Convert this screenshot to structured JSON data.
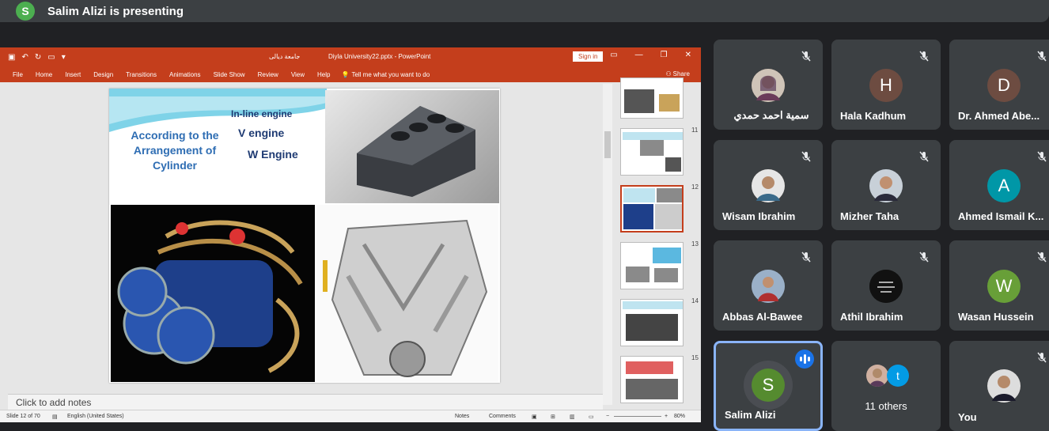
{
  "banner": {
    "avatar_letter": "S",
    "text": "Salim Alizi is presenting"
  },
  "powerpoint": {
    "title_arabic": "جامعة ديالى",
    "title_file": "Diyla University22.pptx  -  PowerPoint",
    "signin_label": "Sign in",
    "menu": [
      "File",
      "Home",
      "Insert",
      "Design",
      "Transitions",
      "Animations",
      "Slide Show",
      "Review",
      "View",
      "Help"
    ],
    "tell_me": "Tell me what you want to do",
    "share": "Share",
    "slide": {
      "inline": "In-line engine",
      "according": "According to the Arrangement of Cylinder",
      "v": "V engine",
      "w": "W Engine"
    },
    "thumb_numbers": [
      "11",
      "12",
      "13",
      "14",
      "15"
    ],
    "notes_placeholder": "Click to add notes",
    "status": {
      "slide": "Slide 12 of 70",
      "lang": "English (United States)",
      "notes": "Notes",
      "comments": "Comments",
      "zoom": "80%"
    }
  },
  "participants": [
    {
      "name": "سمية احمد حمدي",
      "type": "photo",
      "color": "#8a6d5a"
    },
    {
      "name": "Hala Kadhum",
      "letter": "H",
      "color": "#6d4c41"
    },
    {
      "name": "Dr. Ahmed Abe...",
      "letter": "D",
      "color": "#6d4c41"
    },
    {
      "name": "Wisam Ibrahim",
      "type": "photo",
      "color": "#6b5a4a"
    },
    {
      "name": "Mizher Taha",
      "type": "photo",
      "color": "#5a6b7a"
    },
    {
      "name": "Ahmed Ismail K...",
      "letter": "A",
      "color": "#0097a7"
    },
    {
      "name": "Abbas Al-Bawee",
      "type": "photo",
      "color": "#7a8a9a"
    },
    {
      "name": "Athil Ibrahim",
      "type": "photo",
      "color": "#111111"
    },
    {
      "name": "Wasan Hussein",
      "letter": "W",
      "color": "#689f38"
    },
    {
      "name": "Salim Alizi",
      "letter": "S",
      "color": "#558b2f"
    },
    {
      "name": "11 others",
      "letter": "t",
      "color": "#039be5"
    },
    {
      "name": "You",
      "type": "photo",
      "color": "#4a3a30"
    }
  ]
}
